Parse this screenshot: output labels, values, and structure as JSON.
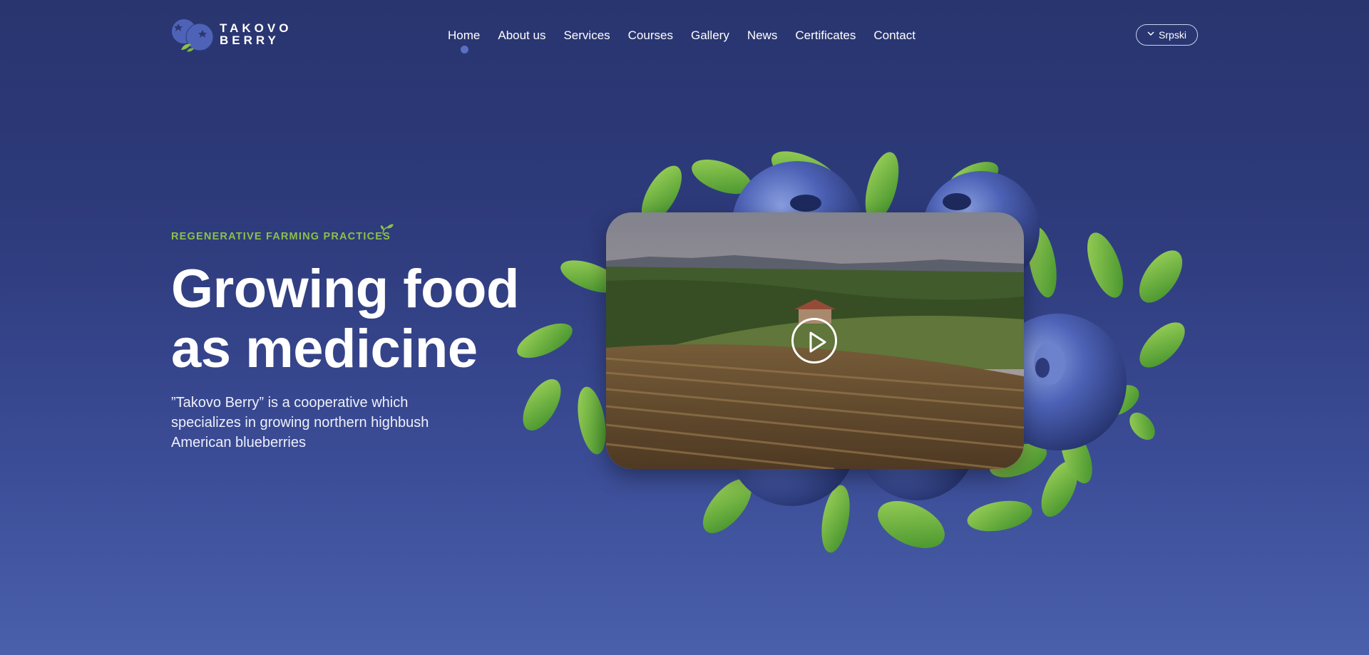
{
  "brand": {
    "name_line1": "TAKOVO",
    "name_line2": "BERRY",
    "colors": {
      "accent_green": "#8cc04a",
      "berry_blue": "#4e63b8",
      "bg_top": "#29356f",
      "bg_bottom": "#4a60ab"
    }
  },
  "nav": {
    "items": [
      {
        "label": "Home",
        "active": true
      },
      {
        "label": "About us"
      },
      {
        "label": "Services"
      },
      {
        "label": "Courses"
      },
      {
        "label": "Gallery"
      },
      {
        "label": "News"
      },
      {
        "label": "Certificates"
      },
      {
        "label": "Contact"
      }
    ]
  },
  "language": {
    "label": "Srpski",
    "icon": "chevron-down-icon"
  },
  "hero": {
    "tagline": "REGENERATIVE FARMING PRACTICES",
    "headline_line1": "Growing food",
    "headline_line2": "as medicine",
    "description": "”Takovo Berry” is a cooperative which specializes in growing northern highbush American blueberries"
  },
  "video": {
    "icon": "play-icon"
  }
}
